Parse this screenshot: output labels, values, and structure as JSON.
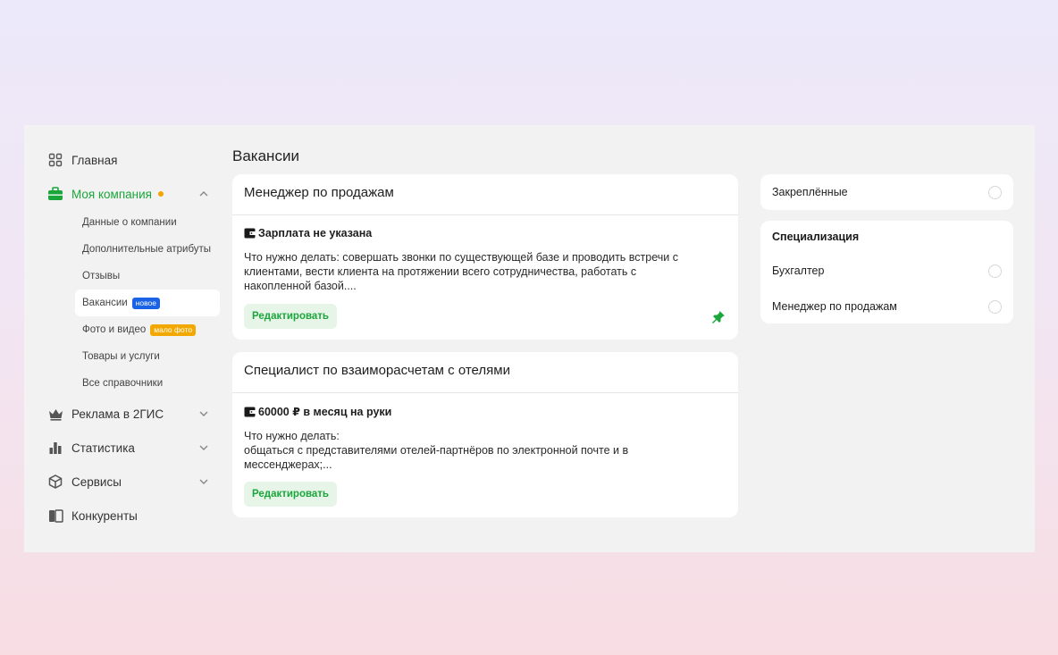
{
  "sidebar": {
    "home": "Главная",
    "my_company": "Моя компания",
    "sub_items": [
      {
        "label": "Данные о компании"
      },
      {
        "label": "Дополнительные атрибуты"
      },
      {
        "label": "Отзывы"
      },
      {
        "label": "Вакансии",
        "badge": "новое"
      },
      {
        "label": "Фото и видео",
        "badge": "мало фото"
      },
      {
        "label": "Товары и услуги"
      },
      {
        "label": "Все справочники"
      }
    ],
    "ads": "Реклама в 2ГИС",
    "stats": "Статистика",
    "services": "Сервисы",
    "competitors": "Конкуренты"
  },
  "main": {
    "title": "Вакансии",
    "vacancies": [
      {
        "title": "Менеджер по продажам",
        "salary": "Зарплата не указана",
        "description": "Что нужно делать: совершать звонки по существующей базе и проводить встречи с\nклиентами, вести клиента на протяжении всего сотрудничества, работать с\nнакопленной базой....",
        "edit_label": "Редактировать",
        "pinned": true
      },
      {
        "title": "Специалист по взаиморасчетам с отелями",
        "salary": "60000 ₽ в месяц на руки",
        "description": "Что нужно делать:\nобщаться с представителями отелей-партнёров по электронной почте и в\nмессенджерах;...",
        "edit_label": "Редактировать",
        "pinned": false
      }
    ]
  },
  "filters": {
    "pinned_label": "Закреплённые",
    "specialization_title": "Специализация",
    "specializations": [
      "Бухгалтер",
      "Менеджер по продажам"
    ]
  },
  "colors": {
    "accent_green": "#1ba63b",
    "badge_blue": "#1b63e6",
    "badge_orange": "#f2a800",
    "dot_orange": "#f5a100"
  }
}
